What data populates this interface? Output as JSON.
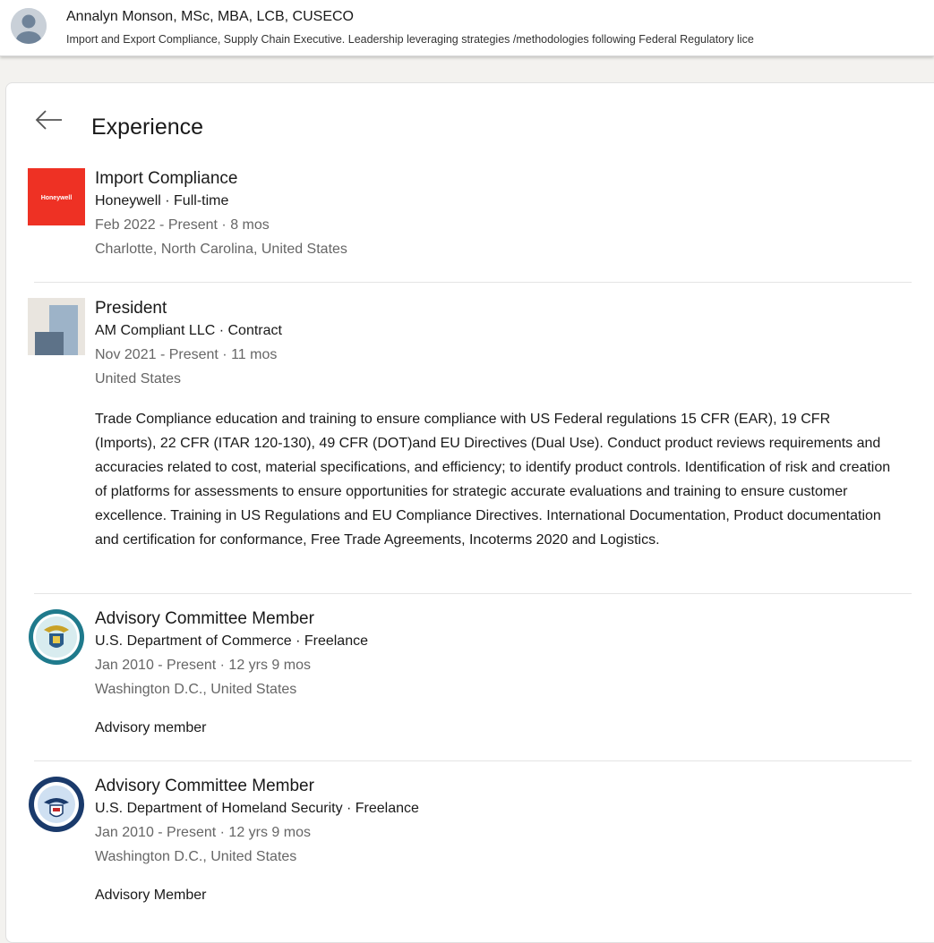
{
  "topbar": {
    "name": "Annalyn Monson, MSc, MBA, LCB, CUSECO",
    "headline": "Import and Export Compliance, Supply Chain Executive. Leadership leveraging strategies /methodologies following Federal Regulatory lice"
  },
  "section": {
    "title": "Experience"
  },
  "experience": [
    {
      "title": "Import Compliance",
      "company": "Honeywell · Full-time",
      "dates": "Feb 2022 - Present · 8 mos",
      "location": "Charlotte, North Carolina, United States",
      "logo_text": "Honeywell",
      "description": ""
    },
    {
      "title": "President",
      "company": "AM Compliant LLC · Contract",
      "dates": "Nov 2021 - Present · 11 mos",
      "location": "United States",
      "description": "Trade Compliance education and training to ensure compliance with US Federal regulations 15 CFR (EAR), 19 CFR (Imports), 22 CFR (ITAR 120-130), 49 CFR (DOT)and EU Directives (Dual Use). Conduct product reviews requirements and accuracies related to cost, material specifications, and efficiency; to identify product controls. Identification of risk and creation of platforms for assessments to ensure opportunities for strategic accurate evaluations and training to ensure customer excellence. Training in US Regulations and EU Compliance Directives. International Documentation, Product documentation and certification for conformance, Free Trade Agreements, Incoterms 2020 and Logistics."
    },
    {
      "title": "Advisory Committee Member",
      "company": "U.S. Department of Commerce · Freelance",
      "dates": "Jan 2010 - Present · 12 yrs 9 mos",
      "location": "Washington D.C., United States",
      "description": "Advisory member"
    },
    {
      "title": "Advisory Committee Member",
      "company": "U.S. Department of Homeland Security · Freelance",
      "dates": "Jan 2010 - Present · 12 yrs 9 mos",
      "location": "Washington D.C., United States",
      "description": "Advisory Member"
    }
  ],
  "colors": {
    "honeywell_red": "#ee3124",
    "commerce_teal": "#1f7a8c",
    "dhs_navy": "#1a3a6b"
  }
}
